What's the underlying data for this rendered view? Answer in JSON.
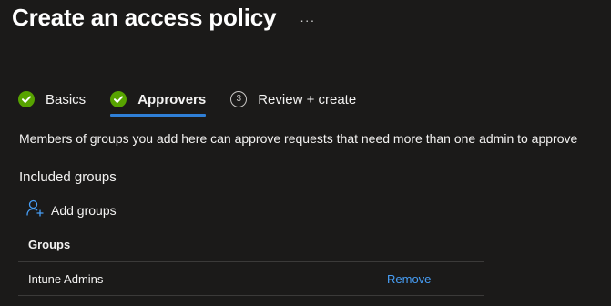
{
  "header": {
    "title": "Create an access policy",
    "more_label": "···"
  },
  "steps": [
    {
      "label": "Basics",
      "state": "completed",
      "icon": "check-circle-icon"
    },
    {
      "label": "Approvers",
      "state": "active-completed",
      "icon": "check-circle-icon"
    },
    {
      "label": "Review + create",
      "state": "pending",
      "number": "3"
    }
  ],
  "colors": {
    "background": "#1b1a19",
    "success": "#57a300",
    "accent": "#2f7fd7",
    "link": "#479ef5"
  },
  "main": {
    "description": "Members of groups you add here can approve requests that need more than one admin to approve",
    "included_label": "Included groups",
    "add_groups_label": "Add groups",
    "add_groups_icon": "add-person-icon",
    "table": {
      "header": "Groups",
      "rows": [
        {
          "name": "Intune Admins",
          "action": "Remove"
        }
      ]
    }
  }
}
